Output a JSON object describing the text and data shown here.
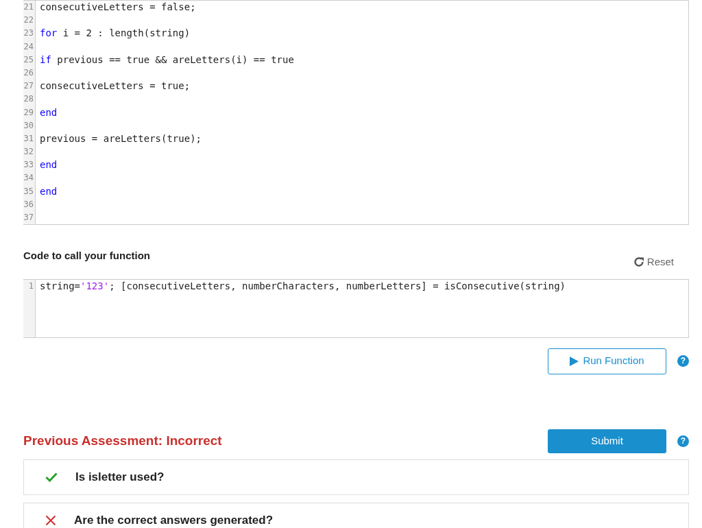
{
  "function_editor": {
    "lines": [
      {
        "number": "21",
        "tokens": [
          {
            "kind": "plain",
            "text": "consecutiveLetters = false;"
          }
        ]
      },
      {
        "number": "22"
      },
      {
        "number": "23",
        "tokens": [
          {
            "kind": "keyword",
            "text": "for"
          },
          {
            "kind": "plain",
            "text": " i = 2 : length(string)"
          }
        ]
      },
      {
        "number": "24"
      },
      {
        "number": "25",
        "tokens": [
          {
            "kind": "keyword",
            "text": "if"
          },
          {
            "kind": "plain",
            "text": " previous == true && areLetters(i) == true"
          }
        ]
      },
      {
        "number": "26"
      },
      {
        "number": "27",
        "tokens": [
          {
            "kind": "plain",
            "text": "consecutiveLetters = true;"
          }
        ]
      },
      {
        "number": "28"
      },
      {
        "number": "29",
        "tokens": [
          {
            "kind": "keyword",
            "text": "end"
          }
        ]
      },
      {
        "number": "30"
      },
      {
        "number": "31",
        "tokens": [
          {
            "kind": "plain",
            "text": "previous = areLetters(true);"
          }
        ]
      },
      {
        "number": "32"
      },
      {
        "number": "33",
        "tokens": [
          {
            "kind": "keyword",
            "text": "end"
          }
        ]
      },
      {
        "number": "34"
      },
      {
        "number": "35",
        "tokens": [
          {
            "kind": "keyword",
            "text": "end"
          }
        ]
      },
      {
        "number": "36"
      },
      {
        "number": "37"
      }
    ]
  },
  "call_section": {
    "title": "Code to call your function",
    "reset_label": "Reset",
    "editor": {
      "lines": [
        {
          "number": "1",
          "tokens": [
            {
              "kind": "plain",
              "text": "string="
            },
            {
              "kind": "string",
              "text": "'123'"
            },
            {
              "kind": "plain",
              "text": "; [consecutiveLetters, numberCharacters, numberLetters] = isConsecutive(string)"
            }
          ]
        }
      ]
    },
    "run_button": "Run Function",
    "help_label": "?"
  },
  "assessment": {
    "title": "Previous Assessment: Incorrect",
    "submit_button": "Submit",
    "help_label": "?",
    "tests": [
      {
        "passed": true,
        "label": "Is isletter used?"
      },
      {
        "passed": false,
        "label": "Are the correct answers generated?"
      }
    ]
  }
}
